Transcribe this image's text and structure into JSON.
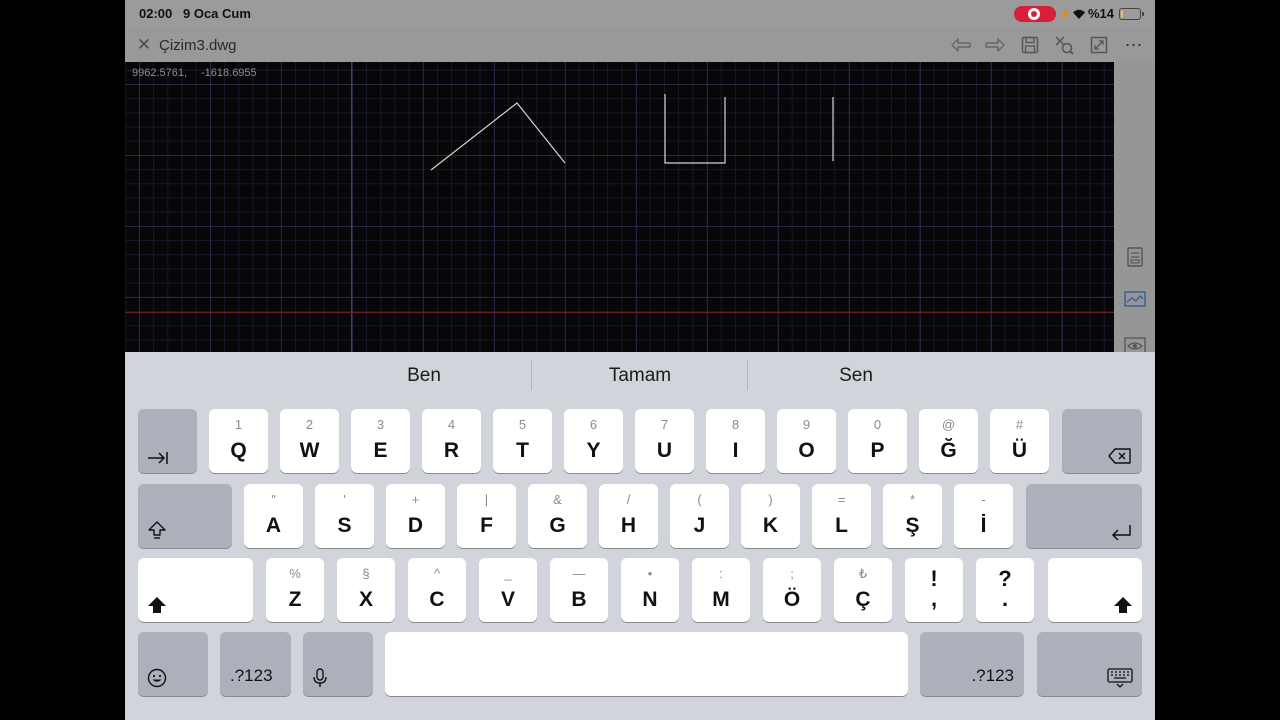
{
  "status_bar": {
    "time": "02:00",
    "date": "9 Oca Cum",
    "battery_text": "%14",
    "battery_level_percent": 14,
    "recording_color": "#d6203a"
  },
  "toolbar": {
    "file_name": "Çizim3.dwg",
    "more_label": "⋯"
  },
  "canvas": {
    "coord_x": "9962.5761,",
    "coord_y": "-1618.6955",
    "background": "#070709"
  },
  "keyboard": {
    "suggestions": [
      "Ben",
      "Tamam",
      "Sen"
    ],
    "rows": [
      [
        {
          "alt": "1",
          "main": "Q"
        },
        {
          "alt": "2",
          "main": "W"
        },
        {
          "alt": "3",
          "main": "E"
        },
        {
          "alt": "4",
          "main": "R"
        },
        {
          "alt": "5",
          "main": "T"
        },
        {
          "alt": "6",
          "main": "Y"
        },
        {
          "alt": "7",
          "main": "U"
        },
        {
          "alt": "8",
          "main": "I"
        },
        {
          "alt": "9",
          "main": "O"
        },
        {
          "alt": "0",
          "main": "P"
        },
        {
          "alt": "@",
          "main": "Ğ"
        },
        {
          "alt": "#",
          "main": "Ü"
        }
      ],
      [
        {
          "alt": "\"",
          "main": "A"
        },
        {
          "alt": "'",
          "main": "S"
        },
        {
          "alt": "+",
          "main": "D"
        },
        {
          "alt": "|",
          "main": "F"
        },
        {
          "alt": "&",
          "main": "G"
        },
        {
          "alt": "/",
          "main": "H"
        },
        {
          "alt": "(",
          "main": "J"
        },
        {
          "alt": ")",
          "main": "K"
        },
        {
          "alt": "=",
          "main": "L"
        },
        {
          "alt": "*",
          "main": "Ş"
        },
        {
          "alt": "-",
          "main": "İ"
        }
      ],
      [
        {
          "alt": "%",
          "main": "Z"
        },
        {
          "alt": "§",
          "main": "X"
        },
        {
          "alt": "^",
          "main": "C"
        },
        {
          "alt": "_",
          "main": "V"
        },
        {
          "alt": "—",
          "main": "B"
        },
        {
          "alt": "•",
          "main": "N"
        },
        {
          "alt": ":",
          "main": "M"
        },
        {
          "alt": ";",
          "main": "Ö"
        },
        {
          "alt": "₺",
          "main": "Ç"
        }
      ]
    ],
    "punct_keys": [
      {
        "top": "!",
        "bottom": ","
      },
      {
        "top": "?",
        "bottom": "."
      }
    ],
    "numbers_label": ".?123",
    "numbers_label_right": ".?123"
  }
}
